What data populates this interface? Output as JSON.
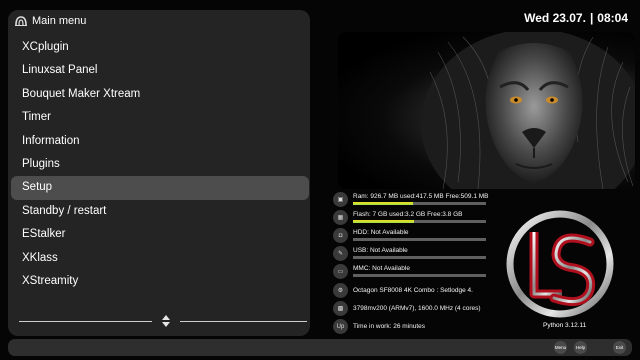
{
  "menu": {
    "title": "Main menu",
    "items": [
      {
        "label": "XCplugin"
      },
      {
        "label": "Linuxsat Panel"
      },
      {
        "label": "Bouquet Maker Xtream"
      },
      {
        "label": "Timer"
      },
      {
        "label": "Information"
      },
      {
        "label": "Plugins"
      },
      {
        "label": "Setup",
        "selected": true
      },
      {
        "label": "Standby / restart"
      },
      {
        "label": "EStalker"
      },
      {
        "label": "XKlass"
      },
      {
        "label": "XStreamity"
      }
    ]
  },
  "clock": {
    "date": "Wed 23.07.",
    "separator": "|",
    "time": "08:04"
  },
  "system_info": {
    "ram": {
      "text": "Ram: 926.7 MB used:417.5 MB Free:509.1 MB",
      "usage": 0.45
    },
    "flash": {
      "text": "Flash: 7 GB used:3.2 GB Free:3.8 GB",
      "usage": 0.46
    },
    "hdd": {
      "text": "HDD: Not Available",
      "usage": 0
    },
    "usb": {
      "text": "USB: Not Available",
      "usage": 0
    },
    "mmc": {
      "text": "MMC: Not Available",
      "usage": 0
    },
    "receiver": {
      "text": "Octagon SF8008 4K Combo : Setlodge 4."
    },
    "cpu": {
      "text": "3798mv200 (ARMv7), 1600.0 MHz (4 cores)"
    },
    "uptime": {
      "icon_label": "Up",
      "text": "Time in work: 26 minutes"
    },
    "python": "Python 3.12.11"
  },
  "footer": {
    "menu_label": "Menu",
    "help_label": "Help",
    "exit_label": "Exit"
  },
  "colors": {
    "background": "#050505",
    "panel": "#242424",
    "selected": "#4d4d4d",
    "bar_fill": "#d8e035",
    "bar_track": "#606060",
    "logo_red": "#b0101e"
  },
  "icons": {
    "ram": "ram-chip-icon",
    "flash": "flash-chip-icon",
    "hdd": "hdd-icon",
    "usb": "usb-icon",
    "mmc": "mmc-card-icon",
    "receiver": "receiver-icon",
    "cpu": "cpu-icon"
  }
}
